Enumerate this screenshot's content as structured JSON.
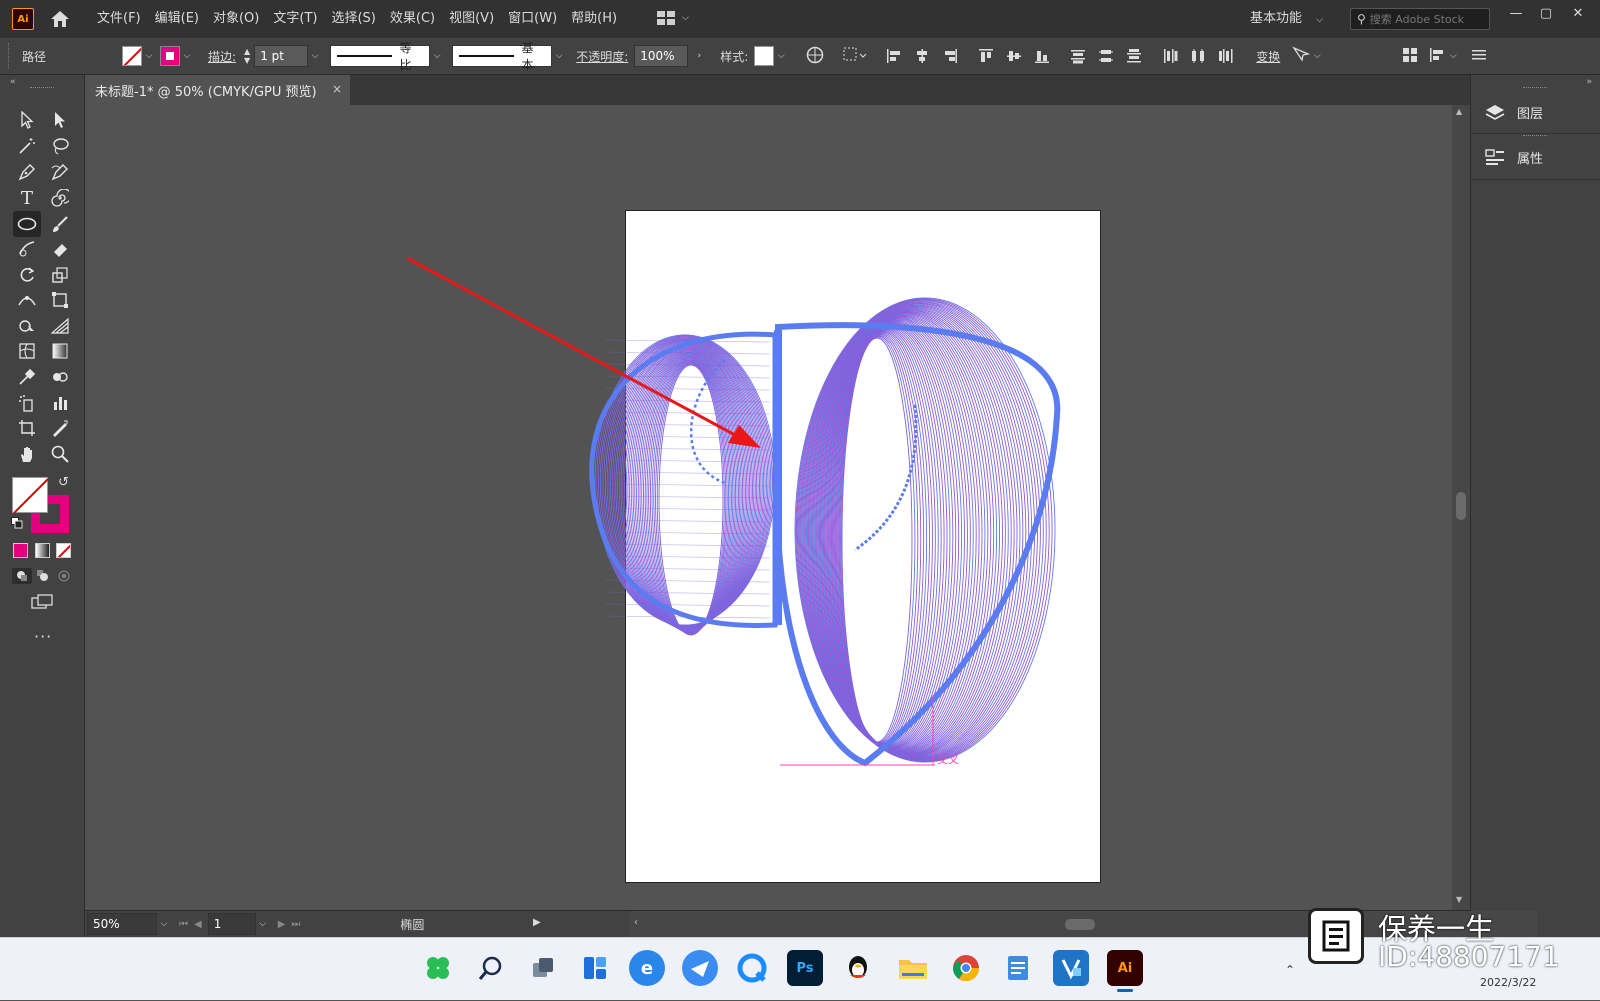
{
  "menubar": {
    "logo": "Ai",
    "items": [
      "文件(F)",
      "编辑(E)",
      "对象(O)",
      "文字(T)",
      "选择(S)",
      "效果(C)",
      "视图(V)",
      "窗口(W)",
      "帮助(H)"
    ],
    "workspace": "基本功能",
    "stock_search_placeholder": "搜索 Adobe Stock"
  },
  "controlbar": {
    "selection_type": "路径",
    "stroke_label": "描边:",
    "stroke_weight": "1 pt",
    "stroke_profile": "等比",
    "brush": "基本",
    "opacity_label": "不透明度:",
    "opacity_value": "100%",
    "style_label": "样式:",
    "transform_label": "变换"
  },
  "document_tab": {
    "title": "未标题-1* @ 50% (CMYK/GPU 预览)",
    "close": "×"
  },
  "canvas": {
    "smart_guide_label": "交叉",
    "accent_color": "#5b7cf0",
    "arrow_color": "#e81818"
  },
  "right_panel": {
    "items": [
      {
        "label": "图层",
        "icon": "layers-icon"
      },
      {
        "label": "属性",
        "icon": "properties-icon"
      }
    ]
  },
  "statusbar": {
    "zoom": "50%",
    "artboard_number": "1",
    "status_text": "椭圆"
  },
  "taskbar": {
    "apps": [
      "start",
      "search",
      "task-view",
      "widgets",
      "edge",
      "feishu",
      "qq-browser",
      "photoshop",
      "qq",
      "file-explorer",
      "chrome",
      "notepad",
      "visio",
      "illustrator"
    ],
    "ps_label": "Ps",
    "ai_label": "Ai",
    "date": "2022/3/22"
  },
  "watermark": {
    "name": "保养一生",
    "id": "ID:48807171"
  }
}
